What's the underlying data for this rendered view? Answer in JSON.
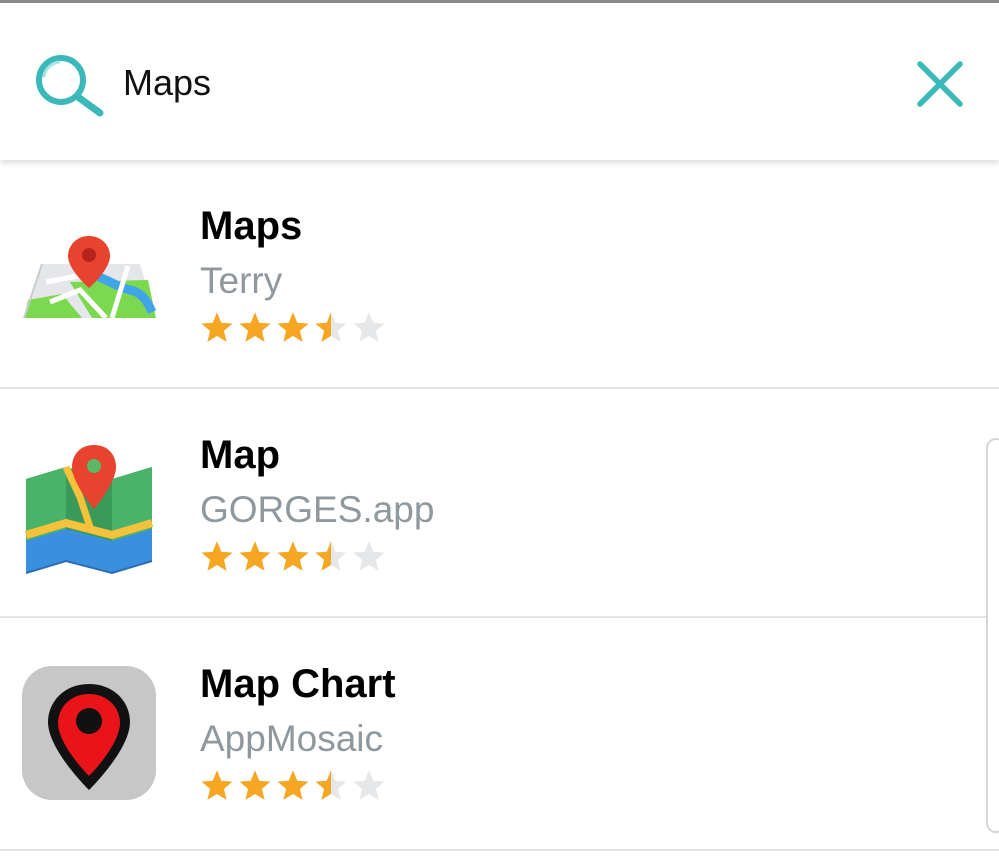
{
  "search": {
    "query": "Maps",
    "placeholder": "",
    "icon": "search-icon",
    "clear_icon": "close-icon",
    "accent_color": "#3bb8b8"
  },
  "results": [
    {
      "name": "Maps",
      "developer": "Terry",
      "icon": "map-pin-paper-icon",
      "rating": 3.5,
      "rating_max": 5
    },
    {
      "name": "Map",
      "developer": "GORGES.app",
      "icon": "folded-map-pin-icon",
      "rating": 3.5,
      "rating_max": 5
    },
    {
      "name": "Map Chart",
      "developer": "AppMosaic",
      "icon": "map-marker-icon",
      "rating": 3.5,
      "rating_max": 5
    }
  ],
  "colors": {
    "star_filled": "#f5a623",
    "star_empty": "#e6e7e8",
    "developer_text": "#8e989f",
    "divider": "#e2e2e2"
  }
}
